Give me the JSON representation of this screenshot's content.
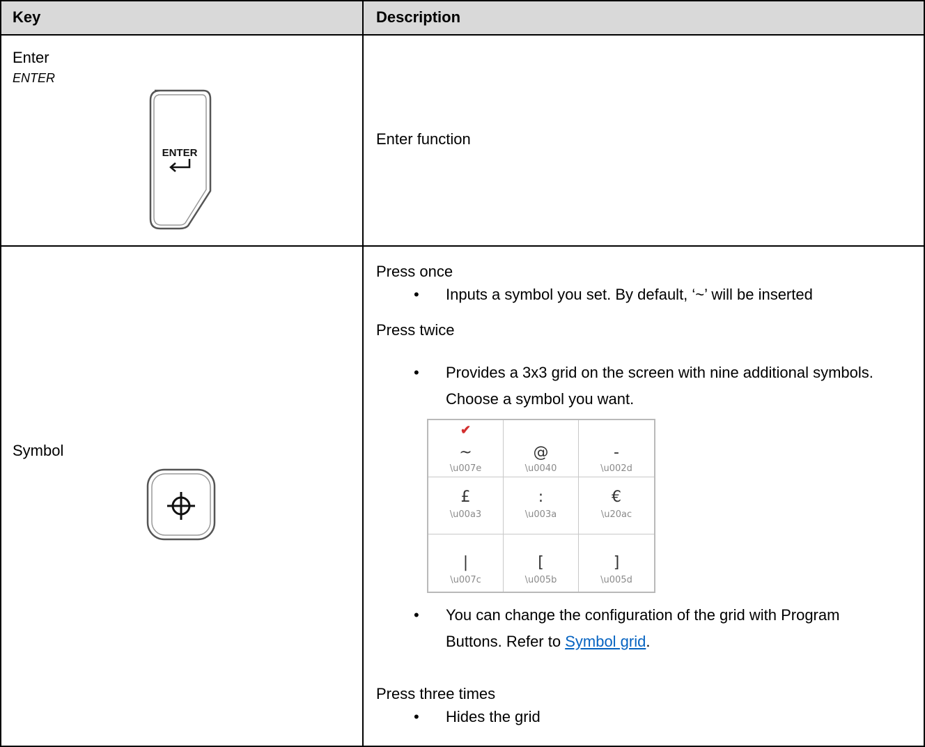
{
  "header": {
    "key_label": "Key",
    "description_label": "Description"
  },
  "rows": [
    {
      "key_name": "Enter",
      "key_sub": "ENTER",
      "key_icon": "enter-key-icon",
      "key_icon_text": "ENTER",
      "description": "Enter function"
    },
    {
      "key_name": "Symbol",
      "key_icon": "crosshair-key-icon",
      "sections": [
        {
          "heading": "Press once",
          "bullets": [
            "Inputs a symbol you set. By default, ‘~’ will be inserted"
          ]
        },
        {
          "heading": "Press twice",
          "bullets": [
            "Provides a 3x3 grid on the screen with nine additional symbols. Choose a symbol you want."
          ]
        },
        {
          "heading": "Press three times",
          "bullets": [
            "Hides the grid"
          ]
        }
      ],
      "after_grid_bullet_pre": "You can change the configuration of the grid with Program Buttons. Refer to ",
      "after_grid_link": "Symbol grid",
      "after_grid_bullet_post": ".",
      "symbol_grid": [
        {
          "symbol": "~",
          "code": "\\u007e",
          "selected": true,
          "check_mark": "✔"
        },
        {
          "symbol": "@",
          "code": "\\u0040"
        },
        {
          "symbol": "-",
          "code": "\\u002d"
        },
        {
          "symbol": "£",
          "code": "\\u00a3"
        },
        {
          "symbol": ":",
          "code": "\\u003a"
        },
        {
          "symbol": "€",
          "code": "\\u20ac"
        },
        {
          "symbol": "|",
          "code": "\\u007c"
        },
        {
          "symbol": "[",
          "code": "\\u005b"
        },
        {
          "symbol": "]",
          "code": "\\u005d"
        }
      ]
    }
  ],
  "colors": {
    "header_bg": "#d9d9d9",
    "link": "#0563c1",
    "check": "#d32f2f"
  }
}
